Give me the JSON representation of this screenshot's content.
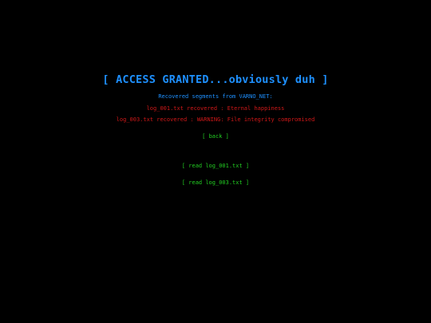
{
  "colors": {
    "background": "#000000",
    "title": "#1e90ff",
    "warning": "#d01818",
    "link": "#22cc22"
  },
  "terminal": {
    "title": "[ ACCESS GRANTED...obviously duh ]",
    "subtitle": "Recovered segments from VARNO_NET:",
    "log_lines": [
      "log_001.txt recovered : Eternal happiness",
      "log_003.txt recovered : WARNING: File integrity compromised"
    ],
    "back_label": "[ back ]",
    "read_links": [
      "[ read log_001.txt ]",
      "[ read log_003.txt ]"
    ]
  }
}
